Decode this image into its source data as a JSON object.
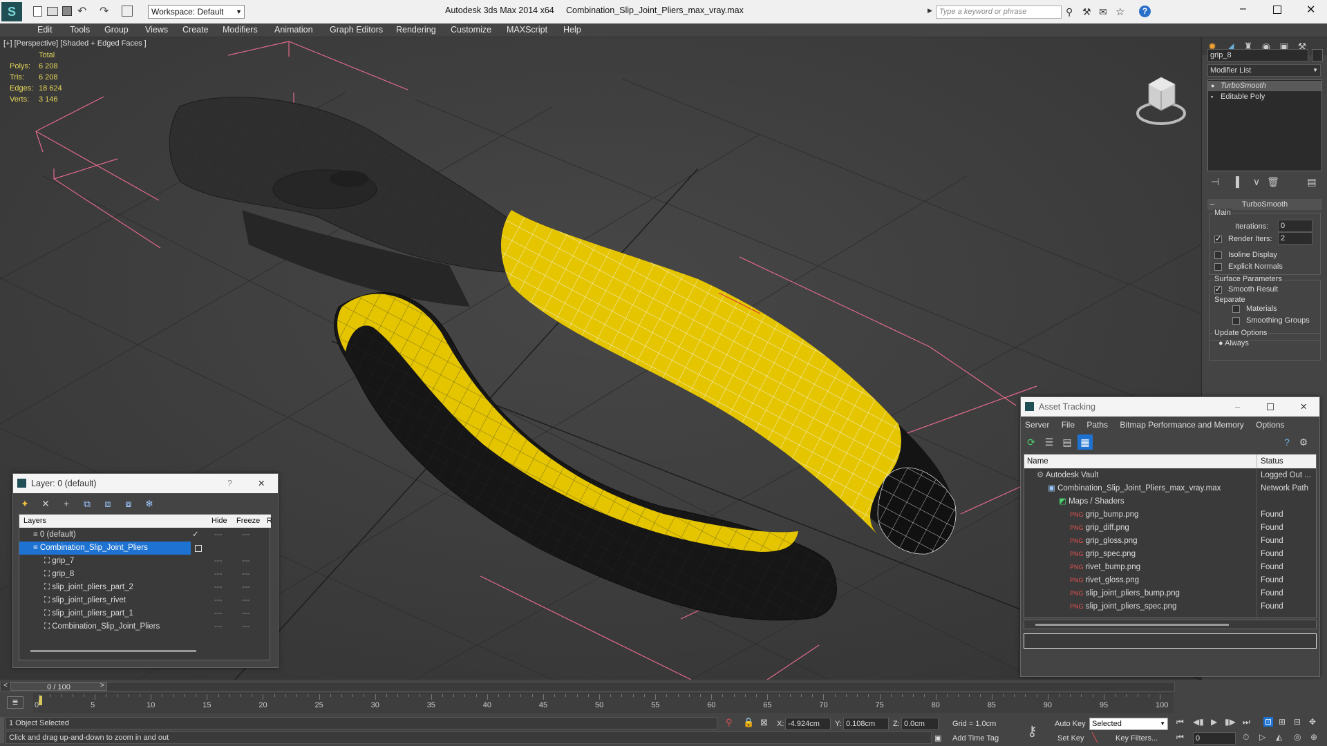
{
  "titlebar": {
    "workspace_label": "Workspace: Default",
    "app_title": "Autodesk 3ds Max  2014 x64",
    "file_name": "Combination_Slip_Joint_Pliers_max_vray.max",
    "search_placeholder": "Type a keyword or phrase"
  },
  "menu": [
    "Edit",
    "Tools",
    "Group",
    "Views",
    "Create",
    "Modifiers",
    "Animation",
    "Graph Editors",
    "Rendering",
    "Customize",
    "MAXScript",
    "Help"
  ],
  "viewport": {
    "label": "[+] [Perspective] [Shaded + Edged Faces ]",
    "stats": {
      "header": "Total",
      "rows": [
        {
          "k": "Polys:",
          "v": "6 208"
        },
        {
          "k": "Tris:",
          "v": "6 208"
        },
        {
          "k": "Edges:",
          "v": "18 624"
        },
        {
          "k": "Verts:",
          "v": "3 146"
        }
      ]
    }
  },
  "cmdpanel": {
    "object_name": "grip_8",
    "modifier_list": "Modifier List",
    "stack": [
      "TurboSmooth",
      "Editable Poly"
    ],
    "rollout_title": "TurboSmooth",
    "main_label": "Main",
    "iterations_label": "Iterations:",
    "iterations_value": "0",
    "render_iters_label": "Render Iters:",
    "render_iters_value": "2",
    "isoline": "Isoline Display",
    "explicit": "Explicit Normals",
    "surface_params": "Surface Parameters",
    "smooth_result": "Smooth Result",
    "separate": "Separate",
    "materials": "Materials",
    "smoothing_groups": "Smoothing Groups",
    "update_options": "Update Options",
    "always": "Always"
  },
  "layer_window": {
    "title": "Layer: 0 (default)",
    "help": "?",
    "col_layers": "Layers",
    "col_hide": "Hide",
    "col_freeze": "Freeze",
    "col_r": "R",
    "rows": [
      {
        "name": "0 (default)"
      },
      {
        "name": "Combination_Slip_Joint_Pliers"
      },
      {
        "name": "grip_7"
      },
      {
        "name": "grip_8"
      },
      {
        "name": "slip_joint_pliers_part_2"
      },
      {
        "name": "slip_joint_pliers_rivet"
      },
      {
        "name": "slip_joint_pliers_part_1"
      },
      {
        "name": "Combination_Slip_Joint_Pliers"
      }
    ]
  },
  "asset_window": {
    "title": "Asset Tracking",
    "menu": [
      "Server",
      "File",
      "Paths",
      "Bitmap Performance and Memory",
      "Options"
    ],
    "col_name": "Name",
    "col_status": "Status",
    "rows": [
      {
        "name": "Autodesk Vault",
        "status": "Logged Out ..."
      },
      {
        "name": "Combination_Slip_Joint_Pliers_max_vray.max",
        "status": "Network Path"
      },
      {
        "name": "Maps / Shaders",
        "status": ""
      },
      {
        "name": "grip_bump.png",
        "status": "Found"
      },
      {
        "name": "grip_diff.png",
        "status": "Found"
      },
      {
        "name": "grip_gloss.png",
        "status": "Found"
      },
      {
        "name": "grip_spec.png",
        "status": "Found"
      },
      {
        "name": "rivet_bump.png",
        "status": "Found"
      },
      {
        "name": "rivet_gloss.png",
        "status": "Found"
      },
      {
        "name": "slip_joint_pliers_bump.png",
        "status": "Found"
      },
      {
        "name": "slip_joint_pliers_spec.png",
        "status": "Found"
      }
    ]
  },
  "timeline": {
    "frame": "0 / 100",
    "ticks": [
      "0",
      "5",
      "10",
      "15",
      "20",
      "25",
      "30",
      "35",
      "40",
      "45",
      "50",
      "55",
      "60",
      "65",
      "70",
      "75",
      "80",
      "85",
      "90",
      "95",
      "100"
    ]
  },
  "status": {
    "selected": "1 Object Selected",
    "hint": "Click and drag up-and-down to zoom in and out",
    "x_label": "X:",
    "x_value": "-4.924cm",
    "y_label": "Y:",
    "y_value": "0.108cm",
    "z_label": "Z:",
    "z_value": "0.0cm",
    "grid": "Grid = 1.0cm",
    "add_time_tag": "Add Time Tag",
    "auto_key": "Auto Key",
    "set_key": "Set Key",
    "key_mode": "Selected",
    "key_filters": "Key Filters...",
    "frame_field": "0"
  },
  "colors": {
    "accent_blue": "#1e73d2",
    "grip_yellow": "#e5c500",
    "stats_yellow": "#e6d75a"
  }
}
